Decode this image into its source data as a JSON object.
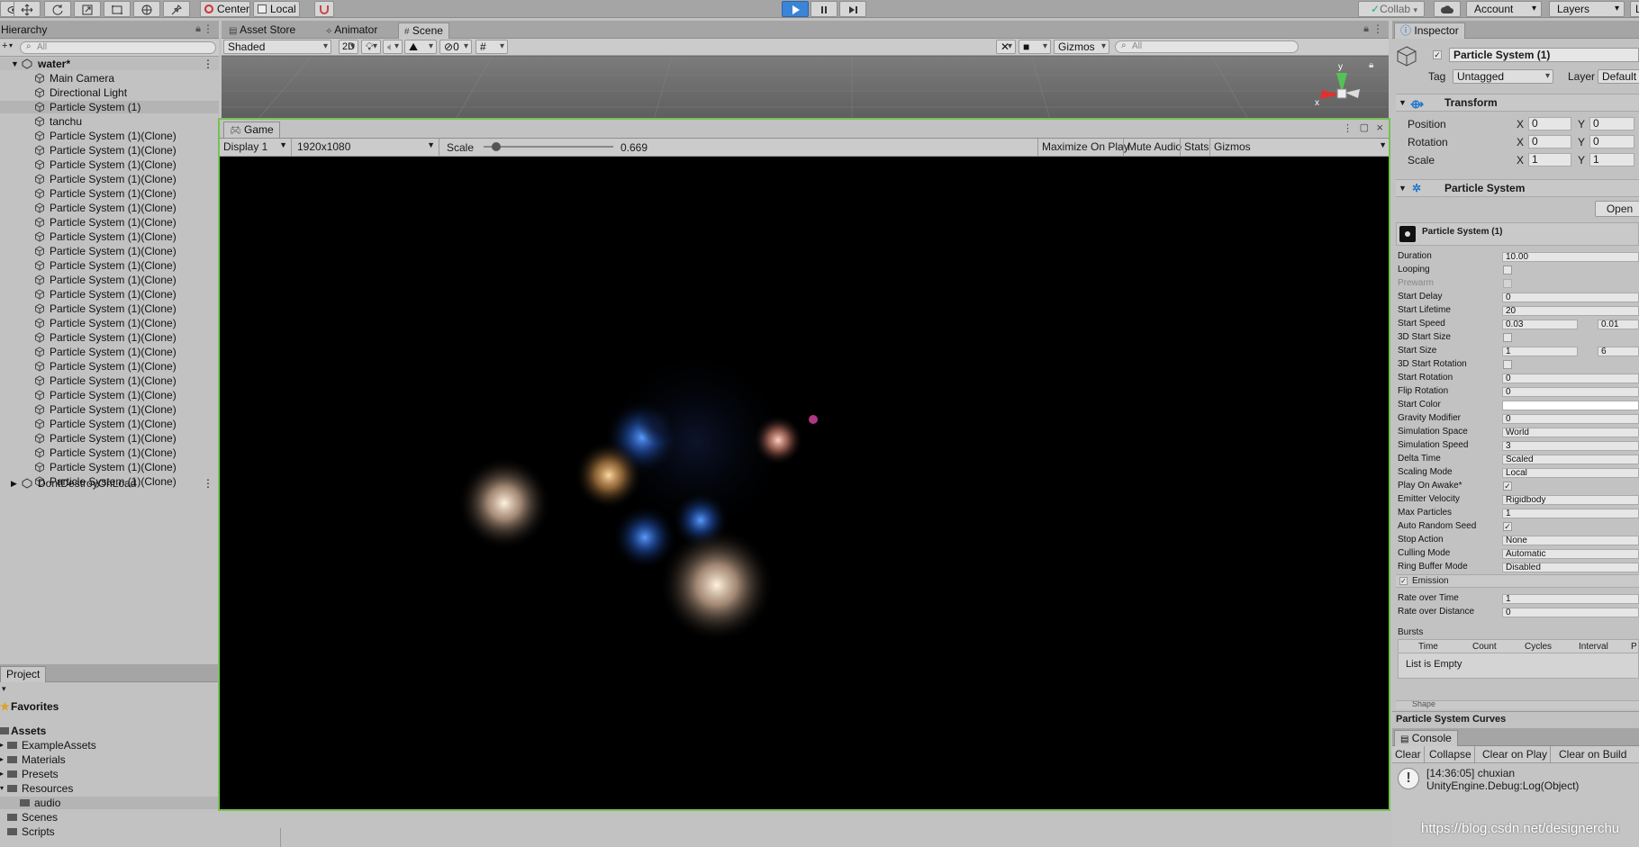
{
  "toolbar": {
    "pivot_label": "Center",
    "space_label": "Local",
    "collab_label": "Collab",
    "account_label": "Account",
    "layers_label": "Layers",
    "layout_label": "L"
  },
  "hierarchy": {
    "title": "Hierarchy",
    "create_label": "+",
    "search_placeholder": "All",
    "scene_name": "water*",
    "items": [
      {
        "label": "Main Camera"
      },
      {
        "label": "Directional Light"
      },
      {
        "label": "Particle System (1)"
      },
      {
        "label": "tanchu"
      },
      {
        "label": "Particle System (1)(Clone)"
      },
      {
        "label": "Particle System (1)(Clone)"
      },
      {
        "label": "Particle System (1)(Clone)"
      },
      {
        "label": "Particle System (1)(Clone)"
      },
      {
        "label": "Particle System (1)(Clone)"
      },
      {
        "label": "Particle System (1)(Clone)"
      },
      {
        "label": "Particle System (1)(Clone)"
      },
      {
        "label": "Particle System (1)(Clone)"
      },
      {
        "label": "Particle System (1)(Clone)"
      },
      {
        "label": "Particle System (1)(Clone)"
      },
      {
        "label": "Particle System (1)(Clone)"
      },
      {
        "label": "Particle System (1)(Clone)"
      },
      {
        "label": "Particle System (1)(Clone)"
      },
      {
        "label": "Particle System (1)(Clone)"
      },
      {
        "label": "Particle System (1)(Clone)"
      },
      {
        "label": "Particle System (1)(Clone)"
      },
      {
        "label": "Particle System (1)(Clone)"
      },
      {
        "label": "Particle System (1)(Clone)"
      },
      {
        "label": "Particle System (1)(Clone)"
      },
      {
        "label": "Particle System (1)(Clone)"
      },
      {
        "label": "Particle System (1)(Clone)"
      },
      {
        "label": "Particle System (1)(Clone)"
      },
      {
        "label": "Particle System (1)(Clone)"
      },
      {
        "label": "Particle System (1)(Clone)"
      },
      {
        "label": "Particle System (1)(Clone)"
      }
    ],
    "dont_destroy": "DontDestroyOnLoad"
  },
  "project": {
    "title": "Project",
    "favorites": "Favorites",
    "assets": "Assets",
    "folders": [
      {
        "label": "ExampleAssets"
      },
      {
        "label": "Materials"
      },
      {
        "label": "Presets"
      },
      {
        "label": "Resources"
      },
      {
        "label": "audio"
      },
      {
        "label": "Scenes"
      },
      {
        "label": "Scripts"
      }
    ]
  },
  "scene": {
    "tabs": [
      {
        "label": "Asset Store"
      },
      {
        "label": "Animator"
      },
      {
        "label": "Scene"
      }
    ],
    "shading": "Shaded",
    "mode_2d": "2D",
    "hidden_count": "0",
    "gizmos": "Gizmos",
    "search_placeholder": "All",
    "axis_y": "y",
    "axis_x": "x"
  },
  "game": {
    "tab": "Game",
    "display": "Display 1",
    "resolution": "1920x1080",
    "scale_label": "Scale",
    "scale_value": "0.669",
    "scale_fraction": 0.1,
    "maximize": "Maximize On Play",
    "mute": "Mute Audio",
    "stats": "Stats",
    "gizmos": "Gizmos"
  },
  "inspector": {
    "title": "Inspector",
    "object_name": "Particle System (1)",
    "tag_label": "Tag",
    "tag_value": "Untagged",
    "layer_label": "Layer",
    "layer_value": "Default",
    "transform": {
      "title": "Transform",
      "rows": [
        {
          "label": "Position",
          "x": "0",
          "y": "0"
        },
        {
          "label": "Rotation",
          "x": "0",
          "y": "0"
        },
        {
          "label": "Scale",
          "x": "1",
          "y": "1"
        }
      ]
    },
    "ps_title": "Particle System",
    "open_editor": "Open",
    "ps_header": "Particle System (1)",
    "props": [
      {
        "label": "Duration",
        "value": "10.00"
      },
      {
        "label": "Looping",
        "checkbox": false
      },
      {
        "label": "Prewarm",
        "checkbox": false,
        "disabled": true
      },
      {
        "label": "Start Delay",
        "value": "0"
      },
      {
        "label": "Start Lifetime",
        "value": "20"
      },
      {
        "label": "Start Speed",
        "value": "0.03",
        "value2": "0.01"
      },
      {
        "label": "3D Start Size",
        "checkbox": false
      },
      {
        "label": "Start Size",
        "value": "1",
        "value2": "6"
      },
      {
        "label": "3D Start Rotation",
        "checkbox": false
      },
      {
        "label": "Start Rotation",
        "value": "0"
      },
      {
        "label": "Flip Rotation",
        "value": "0"
      },
      {
        "label": "Start Color",
        "color": "#ffffff"
      },
      {
        "label": "Gravity Modifier",
        "value": "0"
      },
      {
        "label": "Simulation Space",
        "value": "World"
      },
      {
        "label": "Simulation Speed",
        "value": "3"
      },
      {
        "label": "Delta Time",
        "value": "Scaled"
      },
      {
        "label": "Scaling Mode",
        "value": "Local"
      },
      {
        "label": "Play On Awake*",
        "checkbox": true
      },
      {
        "label": "Emitter Velocity",
        "value": "Rigidbody"
      },
      {
        "label": "Max Particles",
        "value": "1"
      },
      {
        "label": "Auto Random Seed",
        "checkbox": true
      },
      {
        "label": "Stop Action",
        "value": "None"
      },
      {
        "label": "Culling Mode",
        "value": "Automatic"
      },
      {
        "label": "Ring Buffer Mode",
        "value": "Disabled"
      }
    ],
    "emission": {
      "title": "Emission",
      "rows": [
        {
          "label": "Rate over Time",
          "value": "1"
        },
        {
          "label": "Rate over Distance",
          "value": "0"
        }
      ],
      "bursts_label": "Bursts",
      "burst_cols": [
        "Time",
        "Count",
        "Cycles",
        "Interval",
        "P"
      ],
      "empty": "List is Empty"
    },
    "shape": "Shape",
    "curves": "Particle System Curves"
  },
  "console": {
    "title": "Console",
    "buttons": [
      {
        "label": "Clear"
      },
      {
        "label": "Collapse"
      },
      {
        "label": "Clear on Play"
      },
      {
        "label": "Clear on Build"
      }
    ],
    "log_line1": "[14:36:05] chuxian",
    "log_line2": "UnityEngine.Debug:Log(Object)"
  },
  "watermark": "https://blog.csdn.net/designerchu"
}
